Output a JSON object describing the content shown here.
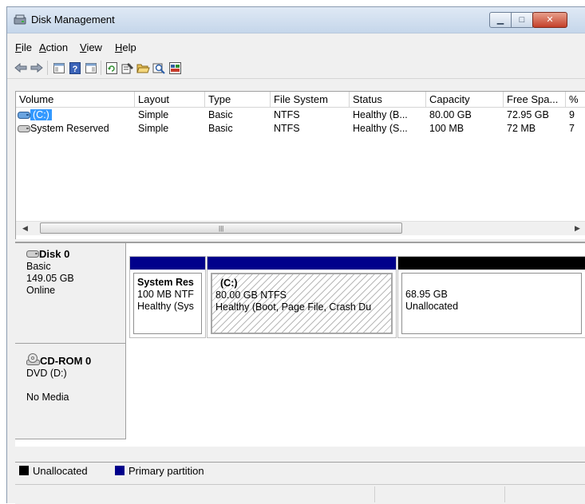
{
  "window": {
    "title": "Disk Management"
  },
  "menu": [
    {
      "label": "File",
      "mnemonic": "F"
    },
    {
      "label": "Action",
      "mnemonic": "A"
    },
    {
      "label": "View",
      "mnemonic": "V"
    },
    {
      "label": "Help",
      "mnemonic": "H"
    }
  ],
  "toolbar": {
    "icons": [
      "back-arrow-icon",
      "forward-arrow-icon",
      "show-hide-console-tree-icon",
      "help-icon",
      "show-hide-action-pane-icon",
      "refresh-icon",
      "properties-icon",
      "open-folder-icon",
      "rescan-disks-icon",
      "disk-view-icon"
    ]
  },
  "volume_list": {
    "columns": [
      "Volume",
      "Layout",
      "Type",
      "File System",
      "Status",
      "Capacity",
      "Free Spa...",
      "%"
    ],
    "rows": [
      {
        "volume": "(C:)",
        "layout": "Simple",
        "type": "Basic",
        "file_system": "NTFS",
        "status": "Healthy (B...",
        "capacity": "80.00 GB",
        "free_space": "72.95 GB",
        "percent": "9"
      },
      {
        "volume": "System Reserved",
        "layout": "Simple",
        "type": "Basic",
        "file_system": "NTFS",
        "status": "Healthy (S...",
        "capacity": "100 MB",
        "free_space": "72 MB",
        "percent": "7"
      }
    ]
  },
  "disks": [
    {
      "name": "Disk 0",
      "type": "Basic",
      "size": "149.05 GB",
      "state": "Online",
      "partitions": [
        {
          "title": "System Res",
          "size": "100 MB NTF",
          "status": "Healthy (Sys",
          "kind": "primary"
        },
        {
          "title": "(C:)",
          "size": "80.00 GB NTFS",
          "status": "Healthy (Boot, Page File, Crash Du",
          "kind": "primary"
        },
        {
          "title": "",
          "size": "68.95 GB",
          "status": "Unallocated",
          "kind": "unallocated"
        }
      ]
    },
    {
      "name": "CD-ROM 0",
      "type": "DVD (D:)",
      "state": "No Media"
    }
  ],
  "legend": [
    {
      "label": "Unallocated",
      "color": "#000000"
    },
    {
      "label": "Primary partition",
      "color": "#00008b"
    }
  ],
  "colors": {
    "primary": "#00008b",
    "unallocated": "#000000",
    "selection": "#3399ff"
  }
}
